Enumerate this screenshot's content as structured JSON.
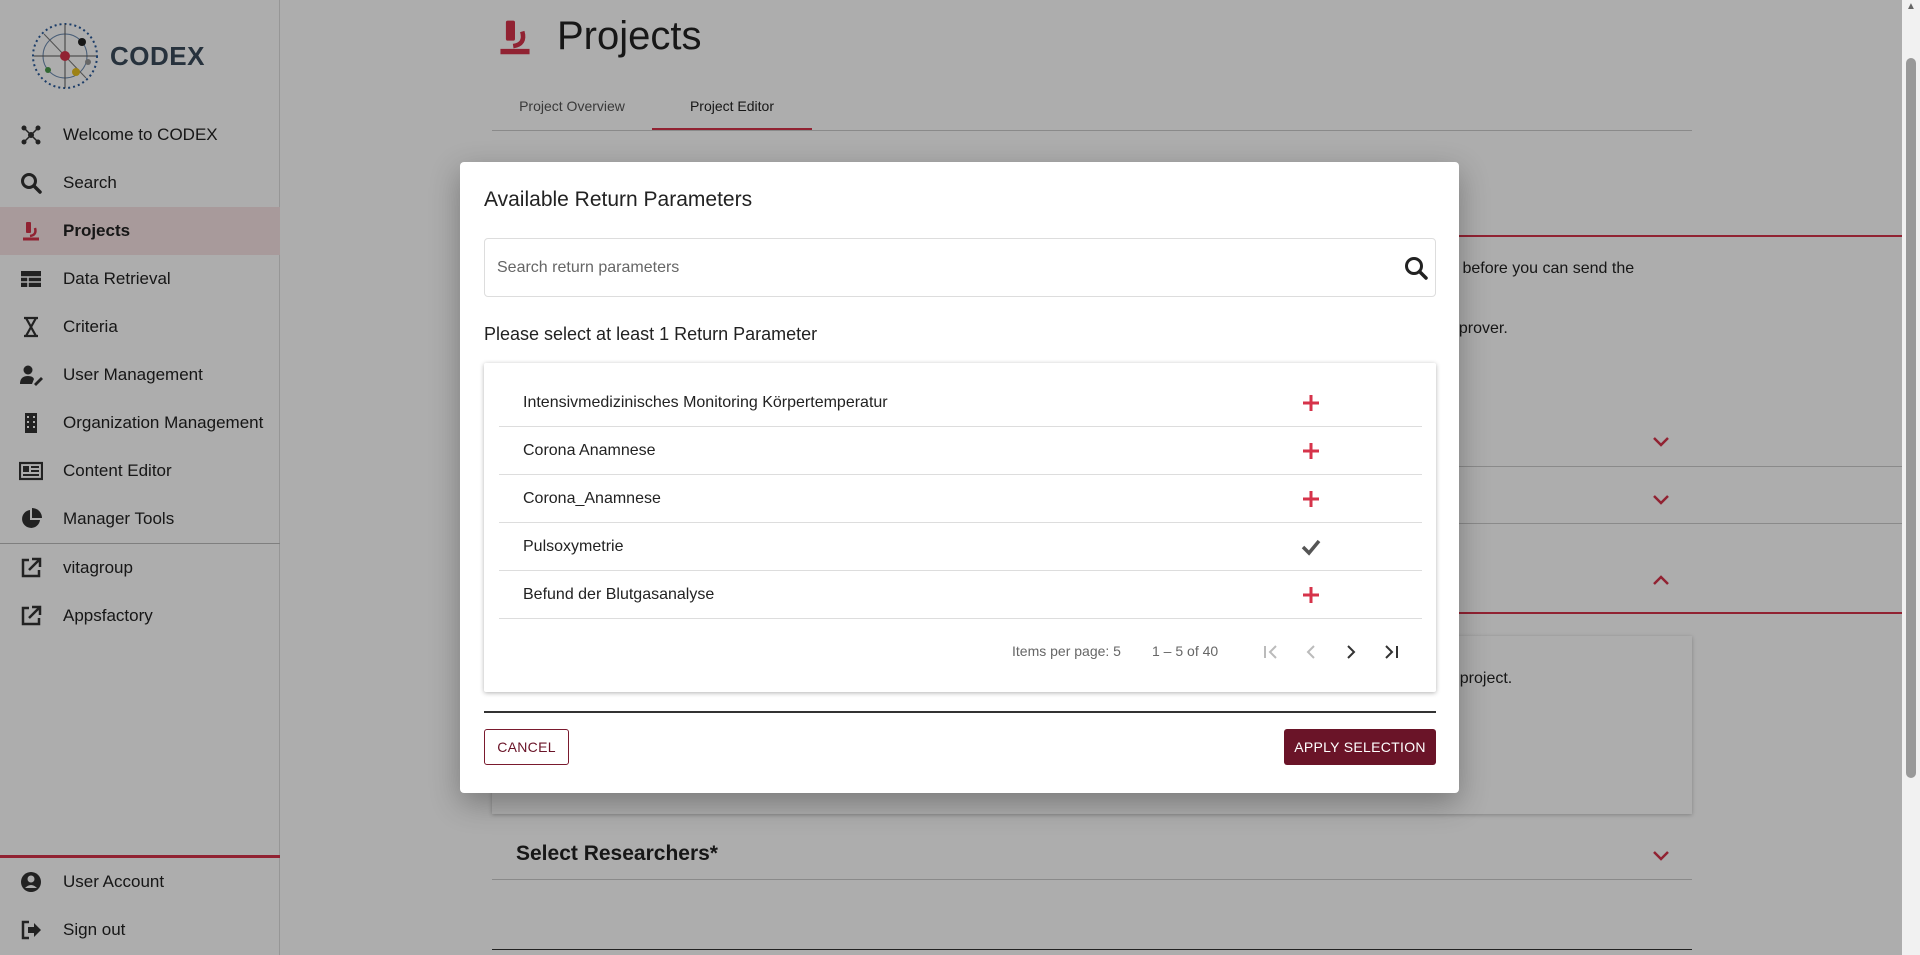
{
  "app": {
    "logo_text": "CODEX"
  },
  "sidebar": {
    "items": [
      {
        "label": "Welcome to CODEX",
        "icon": "molecule-icon"
      },
      {
        "label": "Search",
        "icon": "search-icon"
      },
      {
        "label": "Projects",
        "icon": "microscope-icon",
        "active": true
      },
      {
        "label": "Data Retrieval",
        "icon": "table-icon"
      },
      {
        "label": "Criteria",
        "icon": "hourglass-icon"
      },
      {
        "label": "User Management",
        "icon": "user-edit-icon"
      },
      {
        "label": "Organization Management",
        "icon": "building-icon"
      },
      {
        "label": "Content Editor",
        "icon": "newspaper-icon"
      },
      {
        "label": "Manager Tools",
        "icon": "pie-chart-icon"
      }
    ],
    "links": [
      {
        "label": "vitagroup",
        "icon": "external-link-icon"
      },
      {
        "label": "Appsfactory",
        "icon": "external-link-icon"
      }
    ],
    "bottom": [
      {
        "label": "User Account",
        "icon": "account-circle-icon"
      },
      {
        "label": "Sign out",
        "icon": "sign-out-icon"
      }
    ]
  },
  "page": {
    "title": "Projects",
    "tabs": [
      {
        "label": "Project Overview",
        "active": false
      },
      {
        "label": "Project Editor",
        "active": true
      }
    ],
    "bg_text_1": "k before you can send the",
    "bg_text_2": "pprover.",
    "bg_text_3": "r project.",
    "section_title": "Select Researchers*"
  },
  "dialog": {
    "title": "Available Return Parameters",
    "search_placeholder": "Search return parameters",
    "search_value": "",
    "hint": "Please select at least 1 Return Parameter",
    "rows": [
      {
        "label": "Intensivmedizinisches Monitoring Körpertemperatur",
        "selected": false
      },
      {
        "label": "Corona Anamnese",
        "selected": false
      },
      {
        "label": "Corona_Anamnese",
        "selected": false
      },
      {
        "label": "Pulsoxymetrie",
        "selected": true
      },
      {
        "label": "Befund der Blutgasanalyse",
        "selected": false
      }
    ],
    "paginator": {
      "items_per_page": "Items per page: 5",
      "range": "1 – 5 of 40"
    },
    "cancel_label": "CANCEL",
    "apply_label": "APPLY SELECTION"
  },
  "colors": {
    "accent": "#d6334a",
    "primary_dark": "#6a1428",
    "overlay": "rgba(0,0,0,0.32)"
  }
}
